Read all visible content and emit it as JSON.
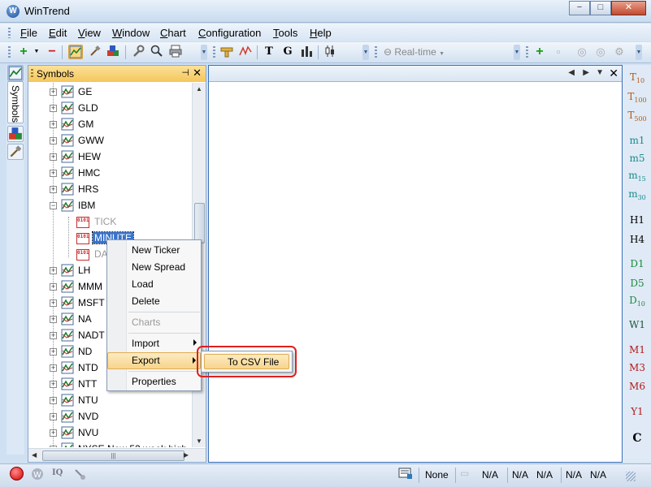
{
  "window": {
    "title": "WinTrend",
    "minimize": "−",
    "maximize": "□",
    "close": "✕"
  },
  "menu": [
    {
      "label": "File",
      "accel": "F",
      "rest": "ile"
    },
    {
      "label": "Edit",
      "accel": "E",
      "rest": "dit"
    },
    {
      "label": "View",
      "accel": "V",
      "rest": "iew"
    },
    {
      "label": "Window",
      "accel": "W",
      "rest": "indow"
    },
    {
      "label": "Chart",
      "accel": "C",
      "rest": "hart"
    },
    {
      "label": "Configuration",
      "accel": "C",
      "rest": "onfiguration"
    },
    {
      "label": "Tools",
      "accel": "T",
      "rest": "ools"
    },
    {
      "label": "Help",
      "accel": "H",
      "rest": "elp"
    }
  ],
  "toolbar": {
    "realtime_label": "Real-time",
    "icons": [
      "add-icon",
      "remove-icon",
      "chart-view-icon",
      "tools-icon",
      "cubes-icon",
      "wrench-icon",
      "search-icon",
      "print-icon",
      "ruler-icon",
      "zigzag-icon",
      "tick-chart-icon",
      "g-chart-icon",
      "bar-chart-icon",
      "candle-icon",
      "realtime-icon",
      "plus-green-icon",
      "square-icon",
      "circle-icon",
      "circle-icon",
      "settings-icon"
    ]
  },
  "left_strip": {
    "symbols_tab": "Symbols"
  },
  "symbols_panel": {
    "title": "Symbols",
    "pin": "⊣",
    "close": "✕",
    "items": [
      {
        "label": "GE",
        "type": "symbol",
        "expanded": false
      },
      {
        "label": "GLD",
        "type": "symbol",
        "expanded": false
      },
      {
        "label": "GM",
        "type": "symbol",
        "expanded": false
      },
      {
        "label": "GWW",
        "type": "symbol",
        "expanded": false
      },
      {
        "label": "HEW",
        "type": "symbol",
        "expanded": false
      },
      {
        "label": "HMC",
        "type": "symbol",
        "expanded": false
      },
      {
        "label": "HRS",
        "type": "symbol",
        "expanded": false
      },
      {
        "label": "IBM",
        "type": "symbol",
        "expanded": true
      },
      {
        "label": "TICK",
        "type": "data",
        "state": "gray"
      },
      {
        "label": "MINUTE",
        "type": "data",
        "state": "selected"
      },
      {
        "label": "DA",
        "type": "data",
        "state": "gray"
      },
      {
        "label": "LH",
        "type": "symbol",
        "expanded": false
      },
      {
        "label": "MMM",
        "type": "symbol",
        "expanded": false
      },
      {
        "label": "MSFT",
        "type": "symbol",
        "expanded": false
      },
      {
        "label": "NA",
        "type": "symbol",
        "expanded": false
      },
      {
        "label": "NADT",
        "type": "symbol",
        "expanded": false
      },
      {
        "label": "ND",
        "type": "symbol",
        "expanded": false
      },
      {
        "label": "NTD",
        "type": "symbol",
        "expanded": false
      },
      {
        "label": "NTT",
        "type": "symbol",
        "expanded": false
      },
      {
        "label": "NTU",
        "type": "symbol",
        "expanded": false
      },
      {
        "label": "NVD",
        "type": "symbol",
        "expanded": false
      },
      {
        "label": "NVU",
        "type": "symbol",
        "expanded": false
      },
      {
        "label": "NYSE New 52 week high",
        "type": "symbol",
        "expanded": false
      }
    ]
  },
  "context_menu": {
    "items": [
      {
        "label": "New Ticker",
        "enabled": true
      },
      {
        "label": "New Spread",
        "enabled": true
      },
      {
        "label": "Load",
        "enabled": true
      },
      {
        "label": "Delete",
        "enabled": true
      },
      {
        "label": "Charts",
        "enabled": false
      },
      {
        "label": "Import",
        "enabled": true,
        "submenu": true
      },
      {
        "label": "Export",
        "enabled": true,
        "submenu": true,
        "highlighted": true
      },
      {
        "label": "Properties",
        "enabled": true
      }
    ],
    "submenu": {
      "label": "To CSV File"
    }
  },
  "timeframes": [
    {
      "main": "T",
      "sub": "10",
      "color": "#b45a1a"
    },
    {
      "main": "T",
      "sub": "100",
      "color": "#b45a1a"
    },
    {
      "main": "T",
      "sub": "500",
      "color": "#b45a1a"
    },
    {
      "main": "m",
      "main2": "1",
      "sub": "",
      "color": "#1a8a8a"
    },
    {
      "main": "m",
      "main2": "5",
      "sub": "",
      "color": "#1a8a8a"
    },
    {
      "main": "m",
      "sub": "15",
      "color": "#1a8a8a"
    },
    {
      "main": "m",
      "sub": "30",
      "color": "#1a8a8a"
    },
    {
      "main": "H1",
      "sub": "",
      "color": "#000000"
    },
    {
      "main": "H4",
      "sub": "",
      "color": "#000000"
    },
    {
      "main": "D1",
      "sub": "",
      "color": "#1a8a3a"
    },
    {
      "main": "D5",
      "sub": "",
      "color": "#1a8a3a"
    },
    {
      "main": "D",
      "sub": "10",
      "color": "#1a8a3a"
    },
    {
      "main": "W1",
      "sub": "",
      "color": "#1a5a3a"
    },
    {
      "main": "M1",
      "sub": "",
      "color": "#b41a1a"
    },
    {
      "main": "M3",
      "sub": "",
      "color": "#b41a1a"
    },
    {
      "main": "M6",
      "sub": "",
      "color": "#b41a1a"
    },
    {
      "main": "Y1",
      "sub": "",
      "color": "#b41a1a"
    },
    {
      "main": "C",
      "sub": "",
      "color": "#000000"
    }
  ],
  "statusbar": {
    "none_label": "None",
    "na_values": [
      "N/A",
      "N/A",
      "N/A",
      "N/A",
      "N/A"
    ]
  },
  "colors": {
    "accent": "#3b73c8",
    "highlight": "#f8d48c",
    "callout": "#e02020"
  }
}
